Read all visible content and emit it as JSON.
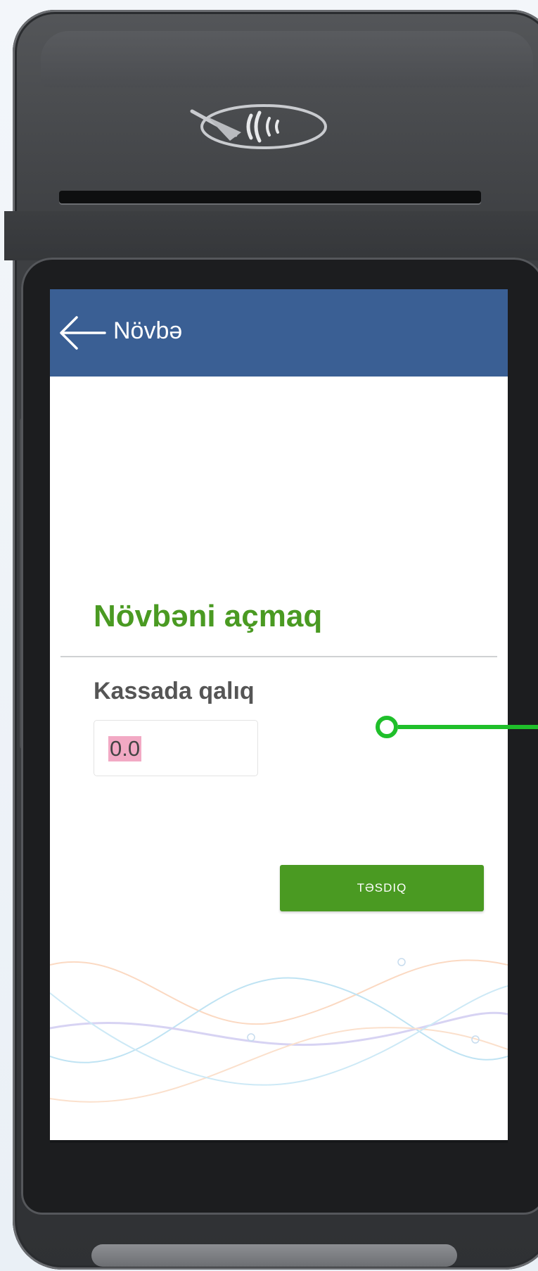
{
  "appbar": {
    "title": "Növbə",
    "background_color": "#3a5f94",
    "back_icon": "arrow-left-icon"
  },
  "form": {
    "section_title": "Növbəni açmaq",
    "field_label": "Kassada qalıq",
    "amount_value": "0.0",
    "confirm_label": "TƏSDIQ"
  },
  "colors": {
    "accent_green": "#4a9a22",
    "callout_green": "#1fbf2a",
    "selection_highlight": "#f2a9c4"
  },
  "device": {
    "nfc_icon": "contactless-payment-icon"
  }
}
